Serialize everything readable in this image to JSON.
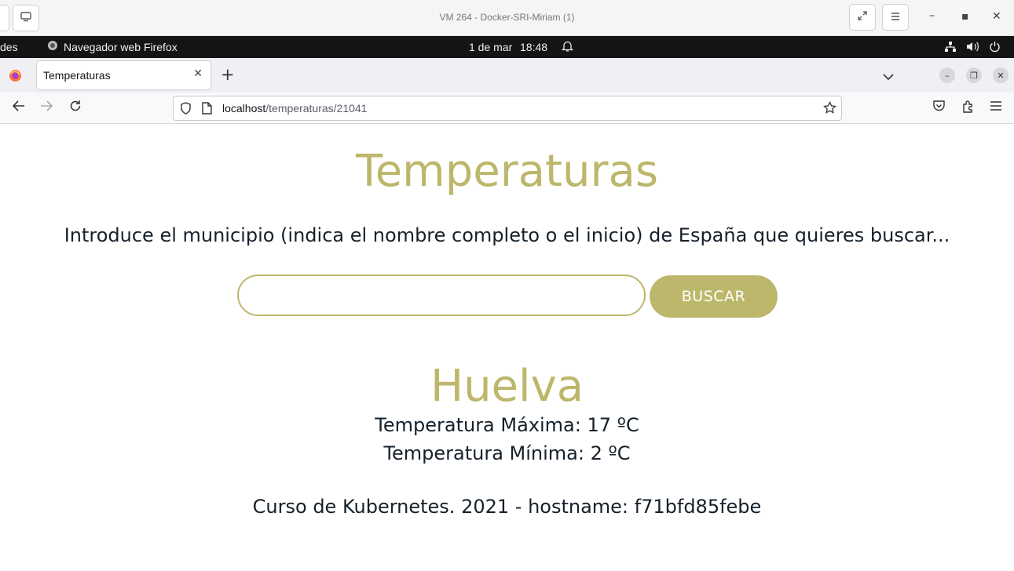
{
  "vm": {
    "title": "VM 264 - Docker-SRI-Miriam (1)"
  },
  "gnome": {
    "activities_partial": "des",
    "app_name": "Navegador web Firefox",
    "date": "1 de mar",
    "time": "18:48"
  },
  "browser": {
    "tab_title": "Temperaturas",
    "url_host": "localhost",
    "url_path": "/temperaturas/21041"
  },
  "page": {
    "title": "Temperaturas",
    "instruction": "Introduce el municipio (indica el nombre completo o el inicio) de España que quieres buscar...",
    "search_value": "",
    "search_button": "BUSCAR",
    "city": "Huelva",
    "temp_max": "Temperatura Máxima: 17 ºC",
    "temp_min": "Temperatura Mínima: 2 ºC",
    "footer": "Curso de Kubernetes. 2021 - hostname: f71bfd85febe"
  },
  "colors": {
    "accent": "#bdb76b",
    "text": "#15202b"
  },
  "icons": [
    "monitor-icon",
    "fullscreen-icon",
    "hamburger-menu-icon",
    "minimize-icon",
    "maximize-icon",
    "close-icon",
    "firefox-icon",
    "bell-icon",
    "network-icon",
    "volume-icon",
    "power-icon",
    "new-tab-icon",
    "tab-list-icon",
    "back-icon",
    "forward-icon",
    "reload-icon",
    "shield-icon",
    "page-icon",
    "bookmark-star-icon",
    "pocket-icon",
    "extensions-icon"
  ]
}
